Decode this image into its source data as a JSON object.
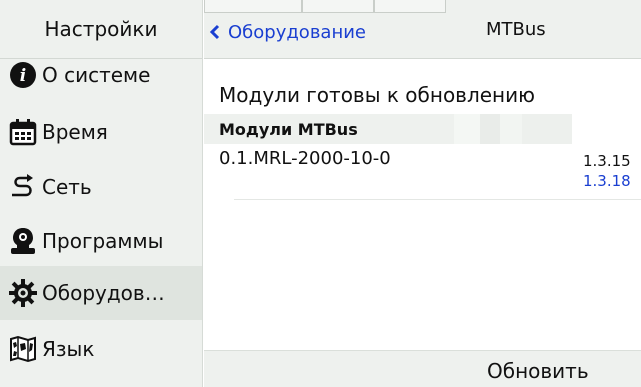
{
  "sidebar": {
    "title": "Настройки",
    "items": [
      {
        "label": "О системе",
        "icon": "info-icon",
        "active": false
      },
      {
        "label": "Время",
        "icon": "calendar-icon",
        "active": false
      },
      {
        "label": "Сеть",
        "icon": "network-icon",
        "active": false
      },
      {
        "label": "Программы",
        "icon": "programs-icon",
        "active": false
      },
      {
        "label": "Оборудов…",
        "icon": "gear-icon",
        "active": true
      },
      {
        "label": "Язык",
        "icon": "map-icon",
        "active": false
      }
    ]
  },
  "topbar": {
    "back_label": "Оборудование",
    "title": "MTBus"
  },
  "content": {
    "section_title": "Модули готовы к обновлению",
    "group_header": "Модули MTBus",
    "module": {
      "name": "0.1.MRL-2000-10-0",
      "current_version": "1.3.15",
      "new_version": "1.3.18"
    },
    "update_label": "Обновить"
  },
  "colors": {
    "accent": "#1a3fd1",
    "sidebar_bg": "#eef1ee",
    "active_bg": "#dfe4df"
  }
}
